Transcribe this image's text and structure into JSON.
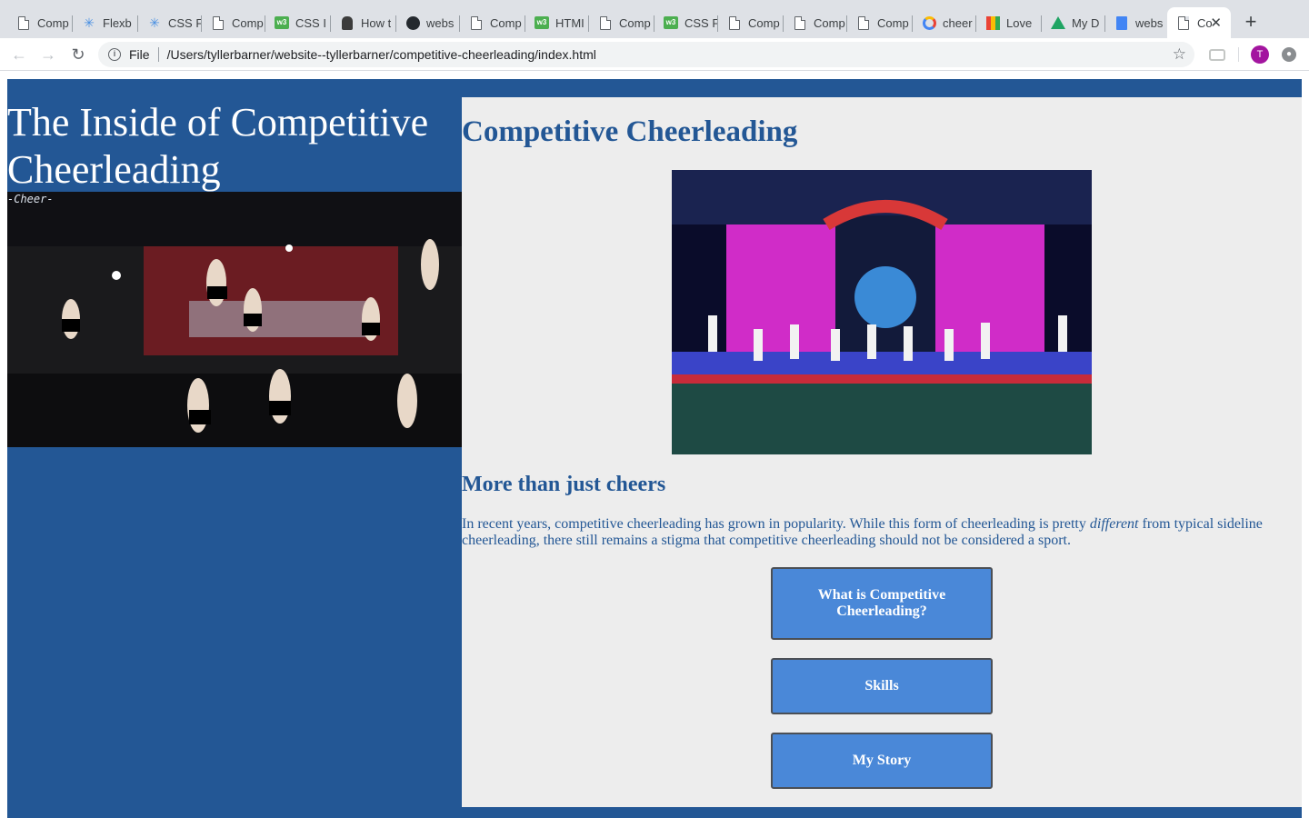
{
  "browser": {
    "tabs": [
      {
        "title": "Comp",
        "icon": "document-icon"
      },
      {
        "title": "Flexb",
        "icon": "star-icon"
      },
      {
        "title": "CSS F",
        "icon": "star-icon"
      },
      {
        "title": "Comp",
        "icon": "document-icon"
      },
      {
        "title": "CSS I",
        "icon": "w3schools-icon"
      },
      {
        "title": "How t",
        "icon": "owl-icon"
      },
      {
        "title": "webs",
        "icon": "github-icon"
      },
      {
        "title": "Comp",
        "icon": "document-icon"
      },
      {
        "title": "HTMI",
        "icon": "w3schools-icon"
      },
      {
        "title": "Comp",
        "icon": "document-icon"
      },
      {
        "title": "CSS F",
        "icon": "w3schools-icon"
      },
      {
        "title": "Comp",
        "icon": "document-icon"
      },
      {
        "title": "Comp",
        "icon": "document-icon"
      },
      {
        "title": "Comp",
        "icon": "document-icon"
      },
      {
        "title": "cheer",
        "icon": "google-icon"
      },
      {
        "title": "Love",
        "icon": "love-icon"
      },
      {
        "title": "My D",
        "icon": "drive-icon"
      },
      {
        "title": "webs",
        "icon": "docs-icon"
      },
      {
        "title": "Co",
        "icon": "document-icon"
      }
    ],
    "w3_badge": "w3",
    "scheme_label": "File",
    "url": "/Users/tyllerbarner/website--tyllerbarner/competitive-cheerleading/index.html",
    "profile_initial": "T"
  },
  "page": {
    "site_title": "The Inside of Competitive Cheerleading",
    "left_image_tag": "-Cheer-",
    "main_title": "Competitive Cheerleading",
    "sub_title": "More than just cheers",
    "body_before": "In recent years, competitive cheerleading has grown in popularity. While this form of cheerleading is pretty ",
    "body_em": "different",
    "body_after": " from typical sideline cheerleading, there still remains a stigma that competitive cheerleading should not be considered a sport.",
    "buttons": [
      {
        "label": "What is Competitive Cheerleading?"
      },
      {
        "label": "Skills"
      },
      {
        "label": "My Story"
      }
    ]
  },
  "colors": {
    "page_blue": "#235795",
    "panel_gray": "#ededed",
    "button_blue": "#4a88d8"
  }
}
